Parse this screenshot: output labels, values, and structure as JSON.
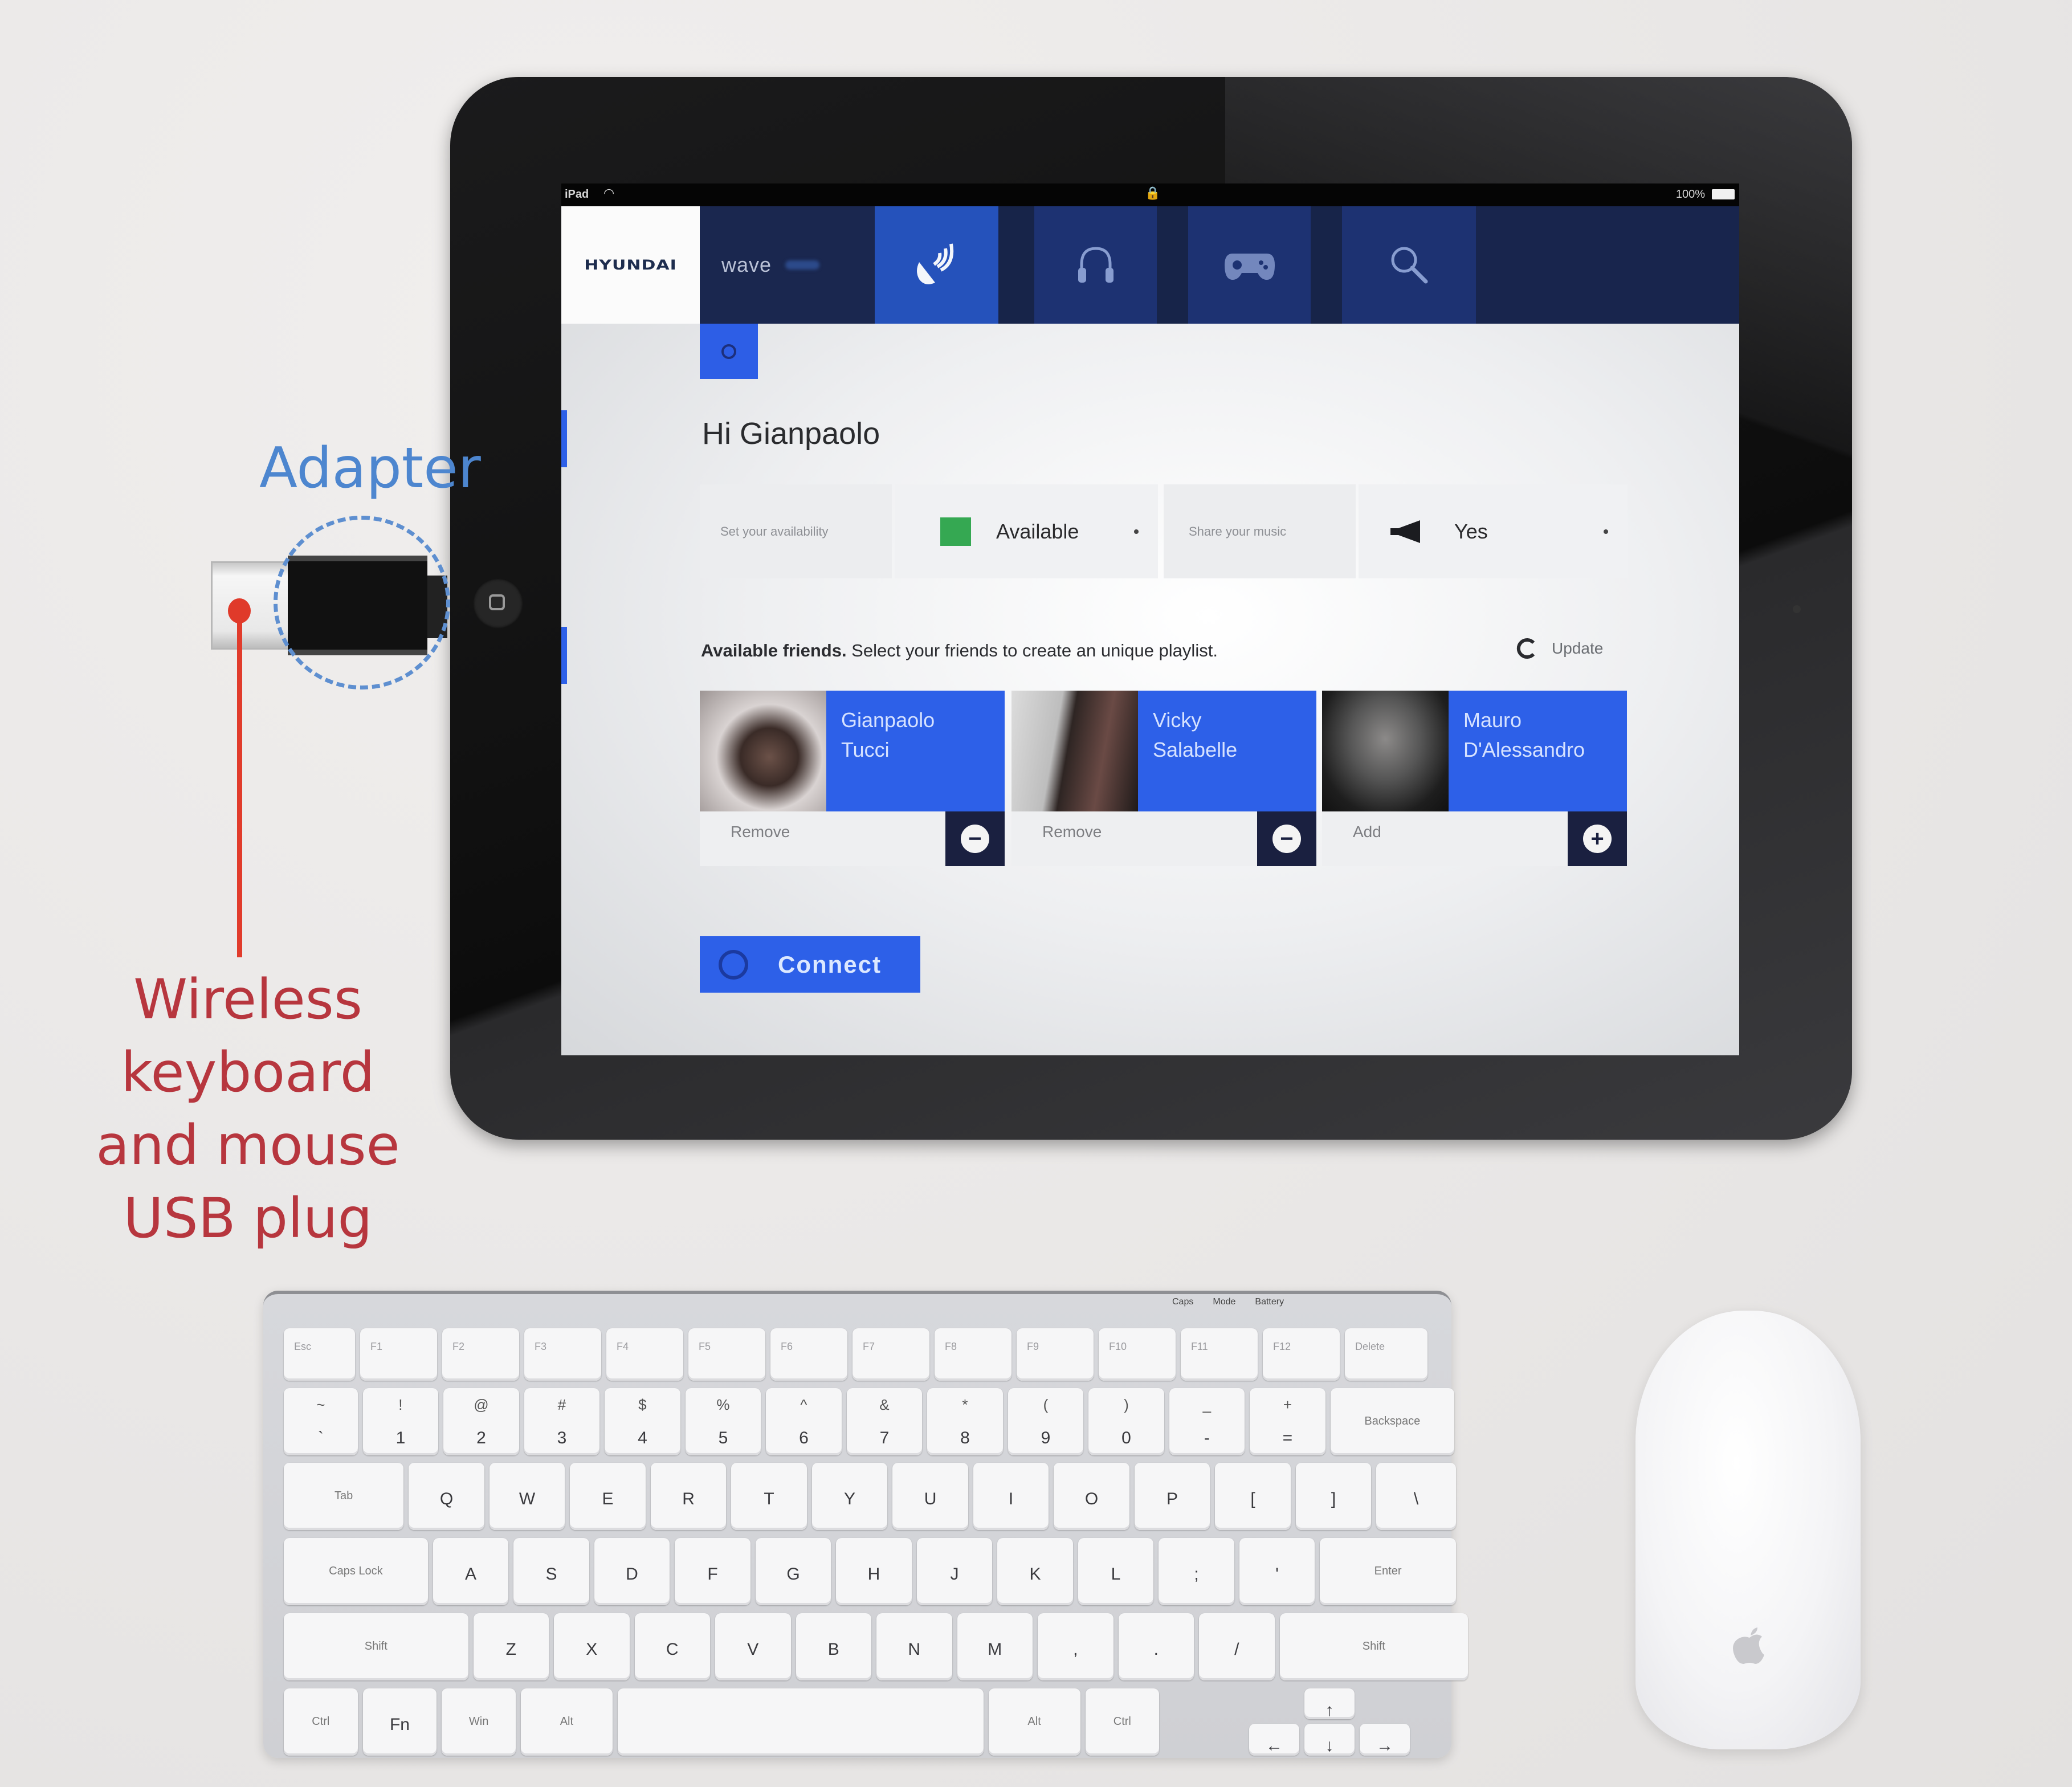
{
  "annotations": {
    "adapter_label": "Adapter",
    "usb_plug_label": [
      "Wireless",
      "keyboard",
      "and mouse",
      "USB plug"
    ],
    "adapter_color": "#4d86cf",
    "usb_label_color": "#b7363e"
  },
  "status_bar": {
    "carrier": "iPad",
    "wifi_icon": "wifi-icon",
    "lock_icon": "lock-icon",
    "battery_text": "100%",
    "battery_icon": "battery-icon"
  },
  "nav": {
    "logo": "HYUNDAI",
    "app_name": "wave",
    "tabs": [
      {
        "name": "cast",
        "icon": "satellite-dish-icon",
        "active": true
      },
      {
        "name": "music",
        "icon": "headphones-icon",
        "active": false
      },
      {
        "name": "games",
        "icon": "gamepad-icon",
        "active": false
      },
      {
        "name": "search",
        "icon": "search-icon",
        "active": false
      }
    ]
  },
  "greeting": "Hi Gianpaolo",
  "selectors": {
    "availability_label": "Set your availability",
    "availability_value": "Available",
    "availability_color": "#35a852",
    "share_music_label": "Share your music",
    "share_music_value": "Yes"
  },
  "friends": {
    "heading_bold": "Available friends.",
    "heading_rest": " Select your friends to create an unique playlist.",
    "update_label": "Update",
    "cards": [
      {
        "first": "Gianpaolo",
        "last": "Tucci",
        "action": "Remove",
        "button": "−"
      },
      {
        "first": "Vicky",
        "last": "Salabelle",
        "action": "Remove",
        "button": "−"
      },
      {
        "first": "Mauro",
        "last": "D'Alessandro",
        "action": "Add",
        "button": "+"
      }
    ]
  },
  "connect_button": "Connect",
  "colors": {
    "accent_blue": "#2d60e8",
    "nav_dark": "#19264f",
    "active_tab": "#2552bb"
  },
  "keyboard": {
    "indicators": [
      "Caps",
      "Mode",
      "Battery"
    ],
    "rows": [
      [
        "Esc",
        "F1",
        "F2",
        "F3",
        "F4",
        "F5",
        "F6",
        "F7",
        "F8",
        "F9",
        "F10",
        "F11",
        "F12",
        "Delete"
      ],
      [
        "`",
        "1",
        "2",
        "3",
        "4",
        "5",
        "6",
        "7",
        "8",
        "9",
        "0",
        "-",
        "=",
        "Backspace"
      ],
      [
        "Tab",
        "Q",
        "W",
        "E",
        "R",
        "T",
        "Y",
        "U",
        "I",
        "O",
        "P",
        "[",
        "]",
        "\\"
      ],
      [
        "Caps Lock",
        "A",
        "S",
        "D",
        "F",
        "G",
        "H",
        "J",
        "K",
        "L",
        ";",
        "'",
        "Enter"
      ],
      [
        "Shift",
        "Z",
        "X",
        "C",
        "V",
        "B",
        "N",
        "M",
        ",",
        ".",
        "/",
        "Shift"
      ],
      [
        "Ctrl",
        "Fn",
        "Win",
        "Alt",
        "",
        "Alt",
        "Ctrl",
        "←",
        "↑",
        "↓",
        "→"
      ]
    ],
    "shift_symbols": [
      "~",
      "!",
      "@",
      "#",
      "$",
      "%",
      "^",
      "&",
      "*",
      "(",
      ")",
      "_",
      "+"
    ]
  },
  "mouse": {
    "logo": "apple-logo-icon"
  }
}
